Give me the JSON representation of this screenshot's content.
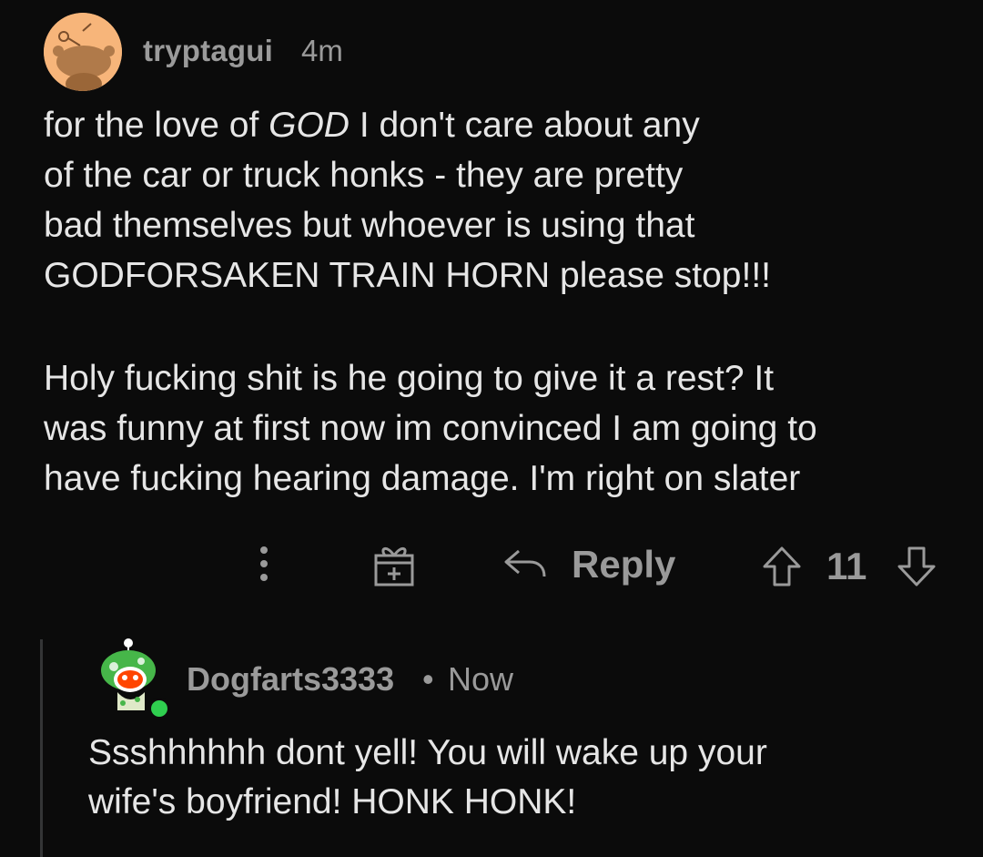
{
  "comment": {
    "username": "tryptagui",
    "time": "4m",
    "avatar_icon": "snoo-avatar-icon",
    "body_paragraph_1": {
      "line1_pre": "for the love of ",
      "line1_emphasis": "GOD",
      "line1_post": " I don't care about any",
      "line2": "of the car or truck honks - they are pretty",
      "line3": "bad themselves but whoever is using that",
      "line4": "GODFORSAKEN TRAIN HORN please stop!!!"
    },
    "body_paragraph_2": {
      "line1": "Holy fucking shit is he going to give it a rest? It",
      "line2": "was funny at first now im convinced I am going to",
      "line3": "have fucking hearing damage. I'm right on slater"
    },
    "actions": {
      "more_icon": "vertical-ellipsis-icon",
      "award_icon": "gift-award-icon",
      "reply_icon": "reply-arrow-icon",
      "reply_label": "Reply",
      "upvote_icon": "upvote-arrow-icon",
      "score": "11",
      "downvote_icon": "downvote-arrow-icon"
    }
  },
  "reply": {
    "username": "Dogfarts3333",
    "separator": "•",
    "time": "Now",
    "avatar_icon": "snoo-avatar-icon",
    "online_indicator_color": "#2fcf4f",
    "body": {
      "line1": "Ssshhhhhh dont yell! You will wake up your",
      "line2": "wife's boyfriend! HONK HONK!"
    }
  },
  "colors": {
    "background": "#0b0b0b",
    "text": "#e6e6e6",
    "meta_text": "#9a9a9a",
    "thread_line": "#343536"
  }
}
